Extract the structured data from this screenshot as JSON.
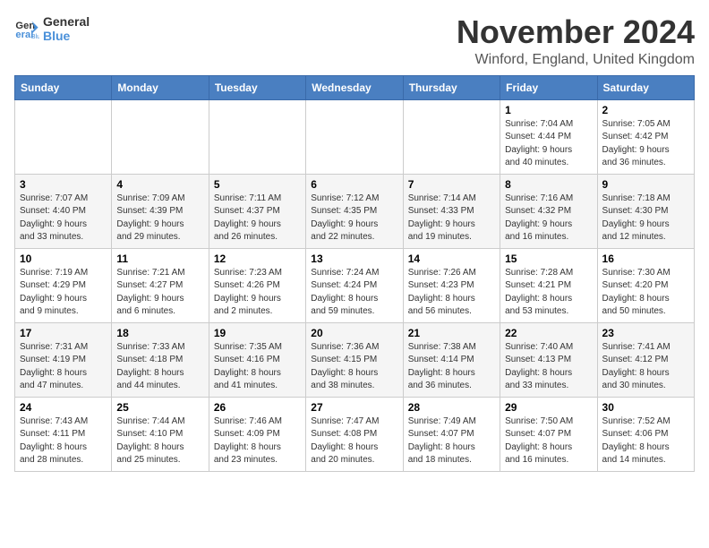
{
  "header": {
    "logo_line1": "General",
    "logo_line2": "Blue",
    "month_title": "November 2024",
    "location": "Winford, England, United Kingdom"
  },
  "weekdays": [
    "Sunday",
    "Monday",
    "Tuesday",
    "Wednesday",
    "Thursday",
    "Friday",
    "Saturday"
  ],
  "weeks": [
    [
      {
        "day": "",
        "info": ""
      },
      {
        "day": "",
        "info": ""
      },
      {
        "day": "",
        "info": ""
      },
      {
        "day": "",
        "info": ""
      },
      {
        "day": "",
        "info": ""
      },
      {
        "day": "1",
        "info": "Sunrise: 7:04 AM\nSunset: 4:44 PM\nDaylight: 9 hours\nand 40 minutes."
      },
      {
        "day": "2",
        "info": "Sunrise: 7:05 AM\nSunset: 4:42 PM\nDaylight: 9 hours\nand 36 minutes."
      }
    ],
    [
      {
        "day": "3",
        "info": "Sunrise: 7:07 AM\nSunset: 4:40 PM\nDaylight: 9 hours\nand 33 minutes."
      },
      {
        "day": "4",
        "info": "Sunrise: 7:09 AM\nSunset: 4:39 PM\nDaylight: 9 hours\nand 29 minutes."
      },
      {
        "day": "5",
        "info": "Sunrise: 7:11 AM\nSunset: 4:37 PM\nDaylight: 9 hours\nand 26 minutes."
      },
      {
        "day": "6",
        "info": "Sunrise: 7:12 AM\nSunset: 4:35 PM\nDaylight: 9 hours\nand 22 minutes."
      },
      {
        "day": "7",
        "info": "Sunrise: 7:14 AM\nSunset: 4:33 PM\nDaylight: 9 hours\nand 19 minutes."
      },
      {
        "day": "8",
        "info": "Sunrise: 7:16 AM\nSunset: 4:32 PM\nDaylight: 9 hours\nand 16 minutes."
      },
      {
        "day": "9",
        "info": "Sunrise: 7:18 AM\nSunset: 4:30 PM\nDaylight: 9 hours\nand 12 minutes."
      }
    ],
    [
      {
        "day": "10",
        "info": "Sunrise: 7:19 AM\nSunset: 4:29 PM\nDaylight: 9 hours\nand 9 minutes."
      },
      {
        "day": "11",
        "info": "Sunrise: 7:21 AM\nSunset: 4:27 PM\nDaylight: 9 hours\nand 6 minutes."
      },
      {
        "day": "12",
        "info": "Sunrise: 7:23 AM\nSunset: 4:26 PM\nDaylight: 9 hours\nand 2 minutes."
      },
      {
        "day": "13",
        "info": "Sunrise: 7:24 AM\nSunset: 4:24 PM\nDaylight: 8 hours\nand 59 minutes."
      },
      {
        "day": "14",
        "info": "Sunrise: 7:26 AM\nSunset: 4:23 PM\nDaylight: 8 hours\nand 56 minutes."
      },
      {
        "day": "15",
        "info": "Sunrise: 7:28 AM\nSunset: 4:21 PM\nDaylight: 8 hours\nand 53 minutes."
      },
      {
        "day": "16",
        "info": "Sunrise: 7:30 AM\nSunset: 4:20 PM\nDaylight: 8 hours\nand 50 minutes."
      }
    ],
    [
      {
        "day": "17",
        "info": "Sunrise: 7:31 AM\nSunset: 4:19 PM\nDaylight: 8 hours\nand 47 minutes."
      },
      {
        "day": "18",
        "info": "Sunrise: 7:33 AM\nSunset: 4:18 PM\nDaylight: 8 hours\nand 44 minutes."
      },
      {
        "day": "19",
        "info": "Sunrise: 7:35 AM\nSunset: 4:16 PM\nDaylight: 8 hours\nand 41 minutes."
      },
      {
        "day": "20",
        "info": "Sunrise: 7:36 AM\nSunset: 4:15 PM\nDaylight: 8 hours\nand 38 minutes."
      },
      {
        "day": "21",
        "info": "Sunrise: 7:38 AM\nSunset: 4:14 PM\nDaylight: 8 hours\nand 36 minutes."
      },
      {
        "day": "22",
        "info": "Sunrise: 7:40 AM\nSunset: 4:13 PM\nDaylight: 8 hours\nand 33 minutes."
      },
      {
        "day": "23",
        "info": "Sunrise: 7:41 AM\nSunset: 4:12 PM\nDaylight: 8 hours\nand 30 minutes."
      }
    ],
    [
      {
        "day": "24",
        "info": "Sunrise: 7:43 AM\nSunset: 4:11 PM\nDaylight: 8 hours\nand 28 minutes."
      },
      {
        "day": "25",
        "info": "Sunrise: 7:44 AM\nSunset: 4:10 PM\nDaylight: 8 hours\nand 25 minutes."
      },
      {
        "day": "26",
        "info": "Sunrise: 7:46 AM\nSunset: 4:09 PM\nDaylight: 8 hours\nand 23 minutes."
      },
      {
        "day": "27",
        "info": "Sunrise: 7:47 AM\nSunset: 4:08 PM\nDaylight: 8 hours\nand 20 minutes."
      },
      {
        "day": "28",
        "info": "Sunrise: 7:49 AM\nSunset: 4:07 PM\nDaylight: 8 hours\nand 18 minutes."
      },
      {
        "day": "29",
        "info": "Sunrise: 7:50 AM\nSunset: 4:07 PM\nDaylight: 8 hours\nand 16 minutes."
      },
      {
        "day": "30",
        "info": "Sunrise: 7:52 AM\nSunset: 4:06 PM\nDaylight: 8 hours\nand 14 minutes."
      }
    ]
  ]
}
